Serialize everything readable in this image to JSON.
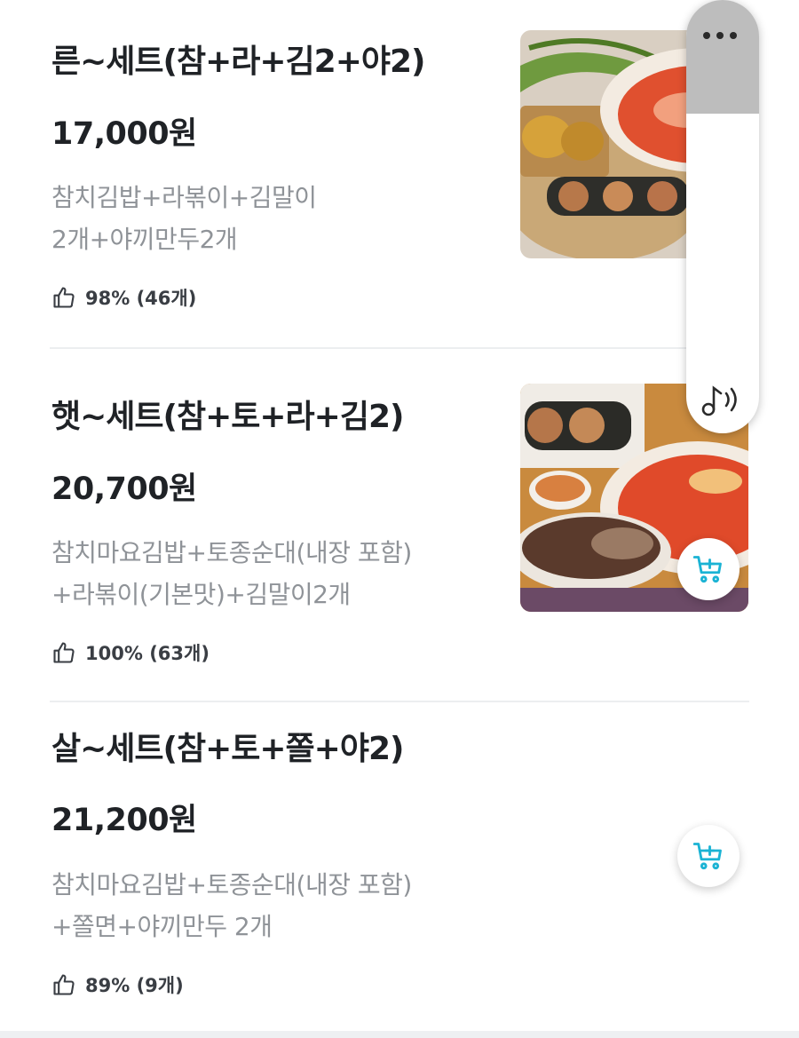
{
  "items": [
    {
      "name": "른~세트(참+라+김2+야2)",
      "price": "17,000원",
      "desc_line1": "참치김밥+라볶이+김말이",
      "desc_line2": "2개+야끼만두2개",
      "rating": "98% (46개)"
    },
    {
      "name": "햇~세트(참+토+라+김2)",
      "price": "20,700원",
      "desc_line1": "참치마요김밥+토종순대(내장 포함)",
      "desc_line2": "+라볶이(기본맛)+김말이2개",
      "rating": "100% (63개)"
    },
    {
      "name": "살~세트(참+토+쫄+야2)",
      "price": "21,200원",
      "desc_line1": "참치마요김밥+토종순대(내장 포함)",
      "desc_line2": "+쫄면+야끼만두 2개",
      "rating": "89% (9개)"
    }
  ],
  "icons": {
    "thumbs_up": "thumbs-up-icon",
    "cart_add": "cart-add-icon",
    "more": "more-dots-icon",
    "sound": "sound-icon"
  },
  "colors": {
    "accent": "#1bb3d4",
    "text": "#1f2226",
    "subtext": "#8f9398"
  }
}
